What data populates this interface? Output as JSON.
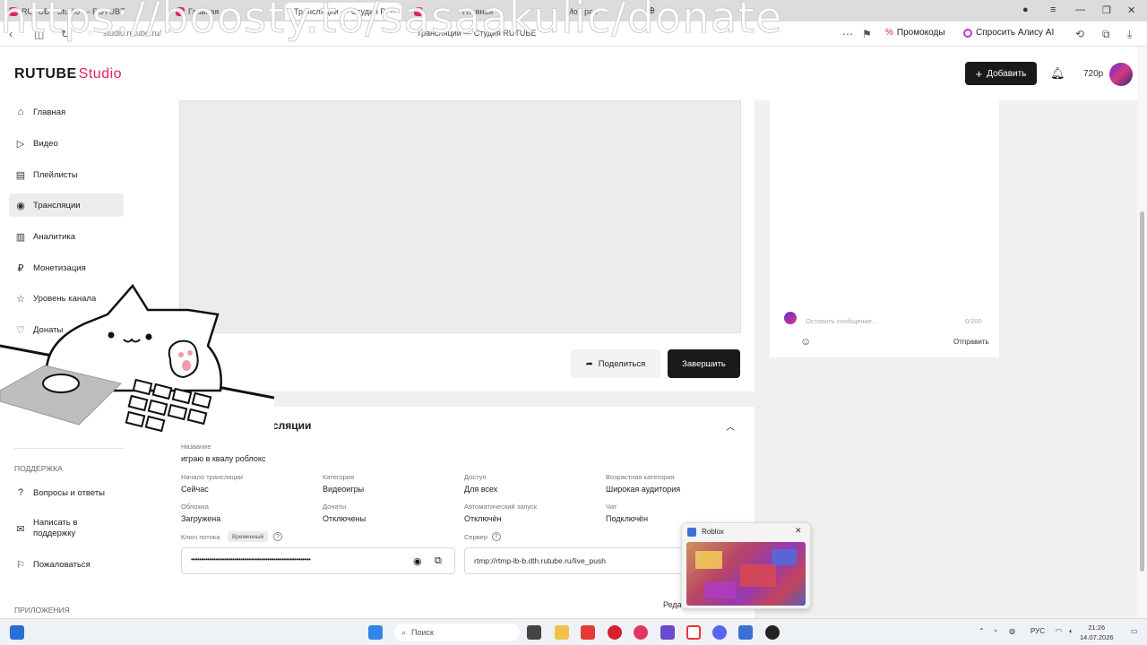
{
  "browser": {
    "tabs": [
      {
        "label": "RUTUBE Studio — RUTUBE",
        "active": false
      },
      {
        "label": "Главная",
        "active": false
      },
      {
        "label": "Трансляции — Студия R",
        "active": true
      },
      {
        "label": "Главная",
        "active": false
      },
      {
        "label": "Мои рас",
        "active": false
      }
    ],
    "url": "studio.rutube.ru/",
    "page_title": "Трансляции — Студия RUTUBE",
    "promocodes": "Промокоды",
    "ask_alice": "Спросить Алису AI",
    "watermark": "https://boosty.to/sasaakulic/donate"
  },
  "app": {
    "logo_main": "RUTUBE",
    "logo_studio": "Studio",
    "add_label": "Добавить",
    "quality": "720p"
  },
  "sidebar": {
    "items": [
      {
        "label": "Главная",
        "icon": "home-icon"
      },
      {
        "label": "Видео",
        "icon": "video-icon"
      },
      {
        "label": "Плейлисты",
        "icon": "playlist-icon"
      },
      {
        "label": "Трансляции",
        "icon": "broadcast-icon",
        "active": true
      },
      {
        "label": "Аналитика",
        "icon": "analytics-icon"
      },
      {
        "label": "Монетизация",
        "icon": "ruble-icon"
      },
      {
        "label": "Уровень канала",
        "icon": "star-icon"
      },
      {
        "label": "Донаты",
        "icon": "donate-icon"
      }
    ],
    "support_title": "ПОДДЕРЖКА",
    "support_items": [
      {
        "label": "Вопросы и ответы",
        "icon": "help-icon"
      },
      {
        "label": "Написать в поддержку",
        "icon": "mail-icon"
      },
      {
        "label": "Пожаловаться",
        "icon": "flag-icon"
      }
    ],
    "apps_title": "ПРИЛОЖЕНИЯ"
  },
  "player": {
    "share_label": "Поделиться",
    "finish_label": "Завершить"
  },
  "chat": {
    "placeholder": "Оставить сообщение...",
    "counter": "0/200",
    "send_label": "Отправить"
  },
  "info": {
    "section_title": "сляции",
    "name_label": "Название",
    "name_value": "играю в квалу роблокс",
    "fields": [
      {
        "label": "Начало трансляции",
        "value": "Сейчас"
      },
      {
        "label": "Категория",
        "value": "Видеоигры"
      },
      {
        "label": "Доступ",
        "value": "Для всех"
      },
      {
        "label": "Возрастная категория",
        "value": "Широкая аудитория"
      },
      {
        "label": "Обложка",
        "value": "Загружена"
      },
      {
        "label": "Донаты",
        "value": "Отключены"
      },
      {
        "label": "Автоматический запуск",
        "value": "Отключён"
      },
      {
        "label": "Чат",
        "value": "Подключён"
      }
    ],
    "key_label": "Ключ потока",
    "key_badge": "Временный",
    "key_value": "••••••••••••••••••••••••••••••••••••••••••••••••••••••••••",
    "server_label": "Сервер",
    "server_value": "rtmp://rtmp-lb-b.dth.rutube.ru/live_push",
    "edit_label": "Реда"
  },
  "popup": {
    "title": "Roblox"
  },
  "taskbar": {
    "search_label": "Поиск",
    "lang": "РУС",
    "time": "21:26",
    "date": "14.07.2026"
  }
}
